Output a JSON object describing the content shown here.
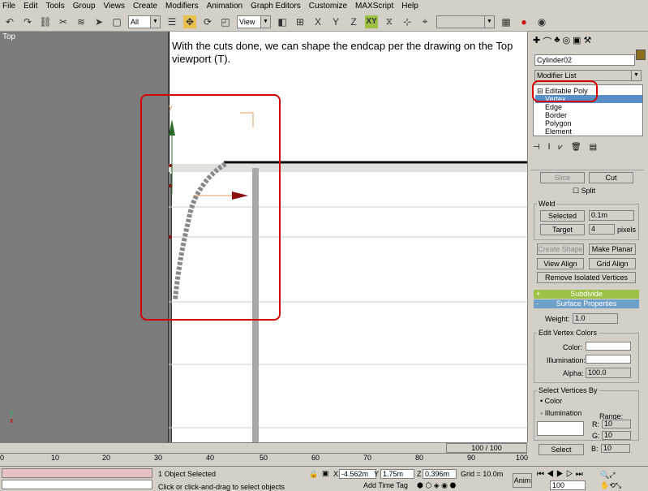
{
  "menu": [
    "File",
    "Edit",
    "Tools",
    "Group",
    "Views",
    "Create",
    "Modifiers",
    "Animation",
    "Graph Editors",
    "Customize",
    "MAXScript",
    "Help"
  ],
  "toolbar": {
    "selection_filter": "All",
    "ref_coord": "View",
    "xy_label": "XY"
  },
  "viewport": {
    "label": "Top",
    "caption": "With the cuts done, we can shape the endcap per the drawing on the Top viewport (T).",
    "axis_y": "y",
    "axis_x_mini": "x",
    "axis_y_mini": "y"
  },
  "command_panel": {
    "object_name": "Cylinder02",
    "object_color": "#8b6f1e",
    "modifier_list": "Modifier List",
    "stack": {
      "root": "Editable Poly",
      "items": [
        "Vertex",
        "Edge",
        "Border",
        "Polygon",
        "Element"
      ],
      "selected": "Vertex"
    },
    "slice": "Slice",
    "cut": "Cut",
    "split": "Split",
    "weld_group": "Weld",
    "selected_btn": "Selected",
    "selected_val": "0.1m",
    "target_btn": "Target",
    "target_val": "4",
    "pixels": "pixels",
    "create_shape": "Create Shape",
    "make_planar": "Make Planar",
    "view_align": "View Align",
    "grid_align": "Grid Align",
    "remove_isolated": "Remove Isolated Vertices",
    "subdivide": "Subdivide",
    "surface_props": "Surface Properties",
    "weight_label": "Weight:",
    "weight_val": "1.0",
    "edit_vertex_colors": "Edit Vertex Colors",
    "color_label": "Color:",
    "illumination_label": "Illumination:",
    "alpha_label": "Alpha:",
    "alpha_val": "100.0",
    "select_by": "Select Vertices By",
    "radio_color": "Color",
    "radio_illum": "Illumination",
    "range": "Range:",
    "r": "R:",
    "g": "G:",
    "b": "B:",
    "r_val": "10",
    "g_val": "10",
    "b_val": "10",
    "select_btn": "Select",
    "plus": "+",
    "minus": "-"
  },
  "timeline": {
    "frame": "100 / 100",
    "ticks": [
      "0",
      "10",
      "20",
      "30",
      "40",
      "50",
      "60",
      "70",
      "80",
      "90",
      "100"
    ]
  },
  "status": {
    "selected": "1 Object Selected",
    "prompt": "Click or click-and-drag to select objects",
    "x_label": "X",
    "x_val": "-4.562m",
    "y_label": "Y",
    "y_val": "1.75m",
    "z_label": "Z",
    "z_val": "0.396m",
    "grid": "Grid = 10.0m",
    "add_time_tag": "Add Time Tag",
    "anim": "Anim",
    "frame": "100"
  }
}
